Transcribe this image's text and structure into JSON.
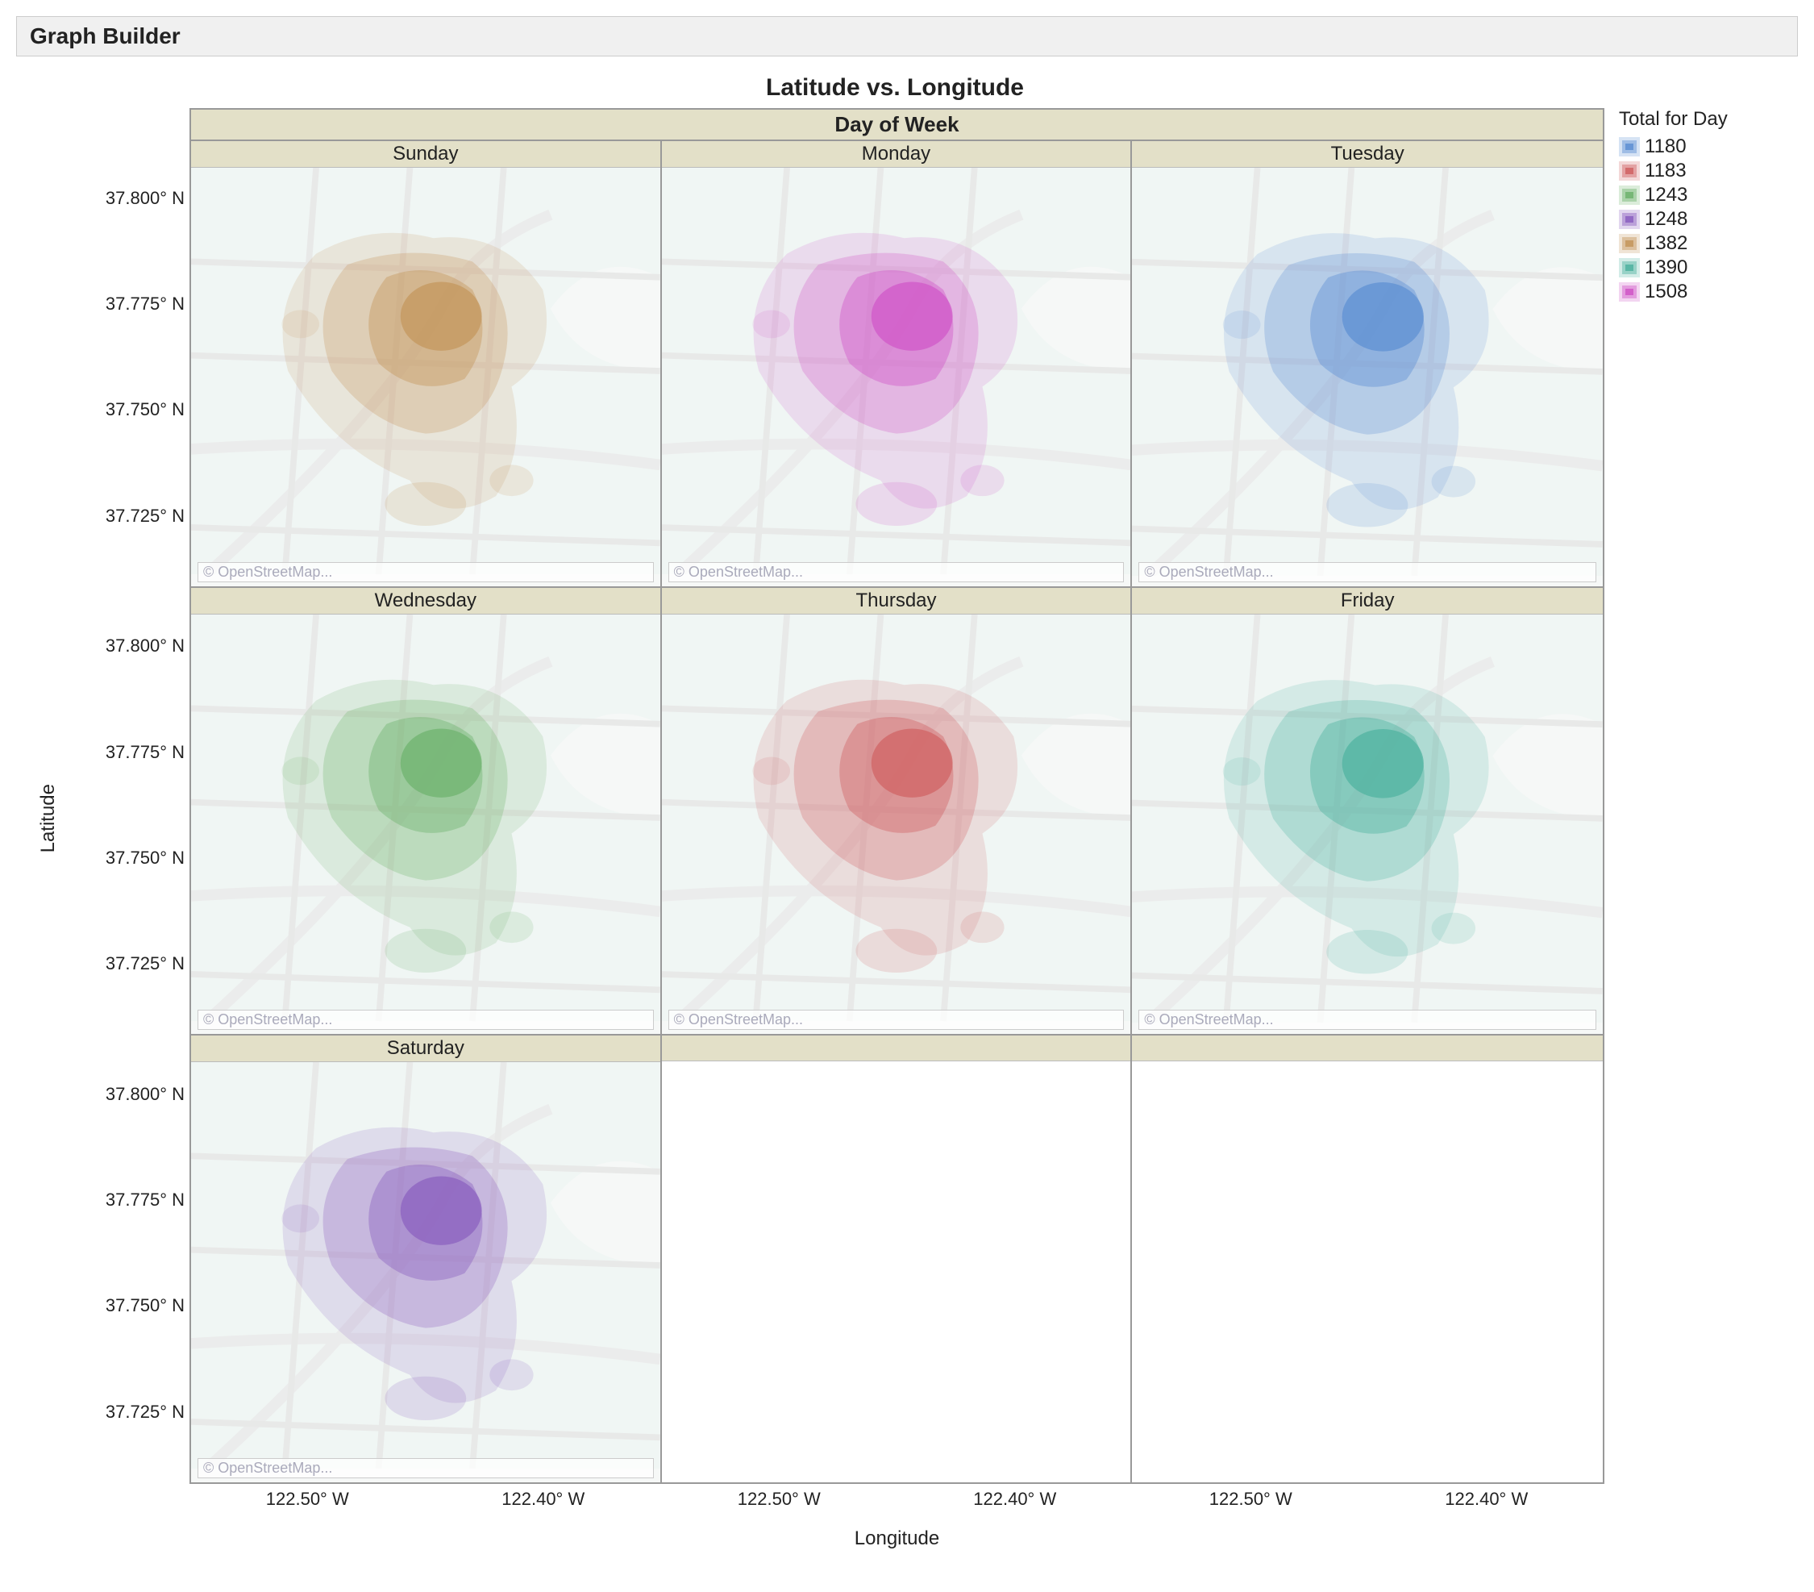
{
  "panel_title": "Graph Builder",
  "chart_title": "Latitude vs. Longitude",
  "wrap_var": "Day of Week",
  "xlabel": "Longitude",
  "ylabel": "Latitude",
  "yticks": [
    "37.800° N",
    "37.775° N",
    "37.750° N",
    "37.725° N"
  ],
  "xticks": [
    "122.50° W",
    "122.40° W"
  ],
  "attribution": "© OpenStreetMap...",
  "legend": {
    "title": "Total for Day",
    "items": [
      {
        "label": "1180",
        "color": "#5d8fd3"
      },
      {
        "label": "1183",
        "color": "#d06263"
      },
      {
        "label": "1243",
        "color": "#6eb36d"
      },
      {
        "label": "1248",
        "color": "#8b5fbf"
      },
      {
        "label": "1382",
        "color": "#c4955b"
      },
      {
        "label": "1390",
        "color": "#4fb3a0"
      },
      {
        "label": "1508",
        "color": "#d056c7"
      }
    ]
  },
  "facets": [
    {
      "label": "Sunday",
      "color": "#c4955b",
      "total": 1382
    },
    {
      "label": "Monday",
      "color": "#d056c7",
      "total": 1508
    },
    {
      "label": "Tuesday",
      "color": "#5d8fd3",
      "total": 1180
    },
    {
      "label": "Wednesday",
      "color": "#6eb36d",
      "total": 1243
    },
    {
      "label": "Thursday",
      "color": "#d06263",
      "total": 1183
    },
    {
      "label": "Friday",
      "color": "#4fb3a0",
      "total": 1390
    },
    {
      "label": "Saturday",
      "color": "#8b5fbf",
      "total": 1248
    }
  ],
  "chart_data": {
    "type": "heatmap",
    "note": "7 small-multiple kernel-density contour maps of San Francisco crime/event locations, one per day of week, colored by daily total.",
    "x_axis": {
      "label": "Longitude",
      "ticks_deg_w": [
        122.5,
        122.4
      ],
      "range_approx": [
        -122.52,
        -122.35
      ]
    },
    "y_axis": {
      "label": "Latitude",
      "ticks_deg_n": [
        37.8,
        37.775,
        37.75,
        37.725
      ],
      "range_approx": [
        37.705,
        37.815
      ]
    },
    "legend_variable": "Total for Day",
    "series": [
      {
        "day": "Sunday",
        "total": 1382,
        "color_hex": "#c4955b",
        "peak_center_lon_lat": [
          -122.41,
          37.785
        ]
      },
      {
        "day": "Monday",
        "total": 1508,
        "color_hex": "#d056c7",
        "peak_center_lon_lat": [
          -122.41,
          37.785
        ]
      },
      {
        "day": "Tuesday",
        "total": 1180,
        "color_hex": "#5d8fd3",
        "peak_center_lon_lat": [
          -122.405,
          37.785
        ]
      },
      {
        "day": "Wednesday",
        "total": 1243,
        "color_hex": "#6eb36d",
        "peak_center_lon_lat": [
          -122.415,
          37.785
        ]
      },
      {
        "day": "Thursday",
        "total": 1183,
        "color_hex": "#d06263",
        "peak_center_lon_lat": [
          -122.41,
          37.782
        ]
      },
      {
        "day": "Friday",
        "total": 1390,
        "color_hex": "#4fb3a0",
        "peak_center_lon_lat": [
          -122.405,
          37.785
        ]
      },
      {
        "day": "Saturday",
        "total": 1248,
        "color_hex": "#8b5fbf",
        "peak_center_lon_lat": [
          -122.415,
          37.783
        ]
      }
    ]
  }
}
